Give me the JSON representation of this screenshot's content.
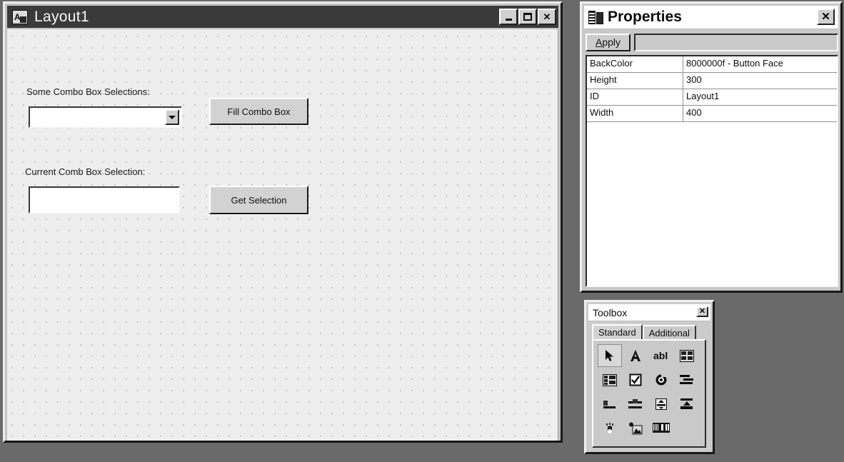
{
  "desktop": {
    "background_color": "#6b6b6b"
  },
  "layout_window": {
    "title": "Layout1",
    "icon": "form-designer-icon",
    "controls": {
      "minimize": "_",
      "maximize": "□",
      "close": "✕"
    },
    "form": {
      "labels": {
        "combo_label": "Some Combo Box Selections:",
        "selection_label": "Current Comb Box Selection:"
      },
      "combo_box": {
        "value": "",
        "dropdown_icon": "chevron-down-icon"
      },
      "text_box": {
        "value": ""
      },
      "buttons": {
        "fill": "Fill Combo Box",
        "get": "Get Selection"
      }
    }
  },
  "properties_window": {
    "title": "Properties",
    "icon": "properties-grid-icon",
    "close_label": "✕",
    "toolbar": {
      "apply_label_prefix": "A",
      "apply_label_rest": "pply",
      "field_value": ""
    },
    "grid": {
      "rows": [
        {
          "name": "BackColor",
          "value": "8000000f - Button Face"
        },
        {
          "name": "Height",
          "value": "300"
        },
        {
          "name": "ID",
          "value": "Layout1"
        },
        {
          "name": "Width",
          "value": "400"
        }
      ]
    }
  },
  "toolbox_window": {
    "title": "Toolbox",
    "close_label": "✕",
    "tabs": [
      {
        "label": "Standard",
        "active": true
      },
      {
        "label": "Additional",
        "active": false
      }
    ],
    "tools": [
      {
        "name": "pointer-tool-icon",
        "selected": true
      },
      {
        "name": "label-tool-icon",
        "selected": false
      },
      {
        "name": "textbox-tool-icon",
        "selected": false
      },
      {
        "name": "frame-tool-icon",
        "selected": false
      },
      {
        "name": "combobox-tool-icon",
        "selected": false
      },
      {
        "name": "checkbox-tool-icon",
        "selected": false
      },
      {
        "name": "optionbutton-tool-icon",
        "selected": false
      },
      {
        "name": "listbox-tool-icon",
        "selected": false
      },
      {
        "name": "scrollbar-tool-icon",
        "selected": false
      },
      {
        "name": "spinbutton-tool-icon",
        "selected": false
      },
      {
        "name": "togglebutton-tool-icon",
        "selected": false
      },
      {
        "name": "tabstrip-tool-icon",
        "selected": false
      },
      {
        "name": "commandbutton-tool-icon",
        "selected": false
      },
      {
        "name": "image-tool-icon",
        "selected": false
      },
      {
        "name": "multipage-tool-icon",
        "selected": false
      }
    ]
  }
}
